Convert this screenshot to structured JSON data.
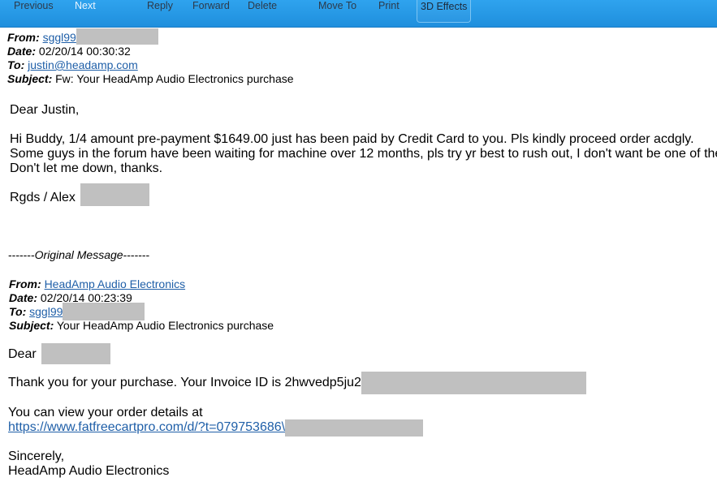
{
  "toolbar": {
    "previous": "Previous",
    "next": "Next",
    "reply": "Reply",
    "forward": "Forward",
    "delete": "Delete",
    "move_to": "Move To",
    "print": "Print",
    "effects": "3D Effects"
  },
  "forwarded": {
    "from_label": "From:",
    "from_value": "sggl99",
    "date_label": "Date:",
    "date_value": "02/20/14 00:30:32",
    "to_label": "To:",
    "to_value": "justin@headamp.com",
    "subject_label": "Subject:",
    "subject_value": "Fw: Your HeadAmp Audio Electronics purchase"
  },
  "body": {
    "greeting": "Dear Justin,",
    "line1": "Hi Buddy, 1/4 amount pre-payment $1649.00 just has been paid by Credit Card to you. Pls kindly proceed order acdgly.",
    "line2": "Some guys in the forum have been waiting for machine over 12 months, pls try yr best to rush out, I don't want be one of them.",
    "line3": "Don't let me down, thanks.",
    "signoff": "Rgds / Alex"
  },
  "original": {
    "divider_left": "-------",
    "divider_text": "Original Message",
    "divider_right": "-------",
    "from_label": "From:",
    "from_value": "HeadAmp Audio Electronics",
    "date_label": "Date:",
    "date_value": "02/20/14 00:23:39",
    "to_label": "To:",
    "to_value": "sggl99",
    "subject_label": "Subject:",
    "subject_value": "Your HeadAmp Audio Electronics purchase",
    "greeting": "Dear",
    "invoice_line": "Thank you for your purchase. Your Invoice ID is 2hwvedp5ju2",
    "details_line": "You can view your order details at",
    "details_link": "https://www.fatfreecartpro.com/d/?t=079753686\\",
    "closing": "Sincerely,",
    "company": "HeadAmp Audio Electronics"
  }
}
